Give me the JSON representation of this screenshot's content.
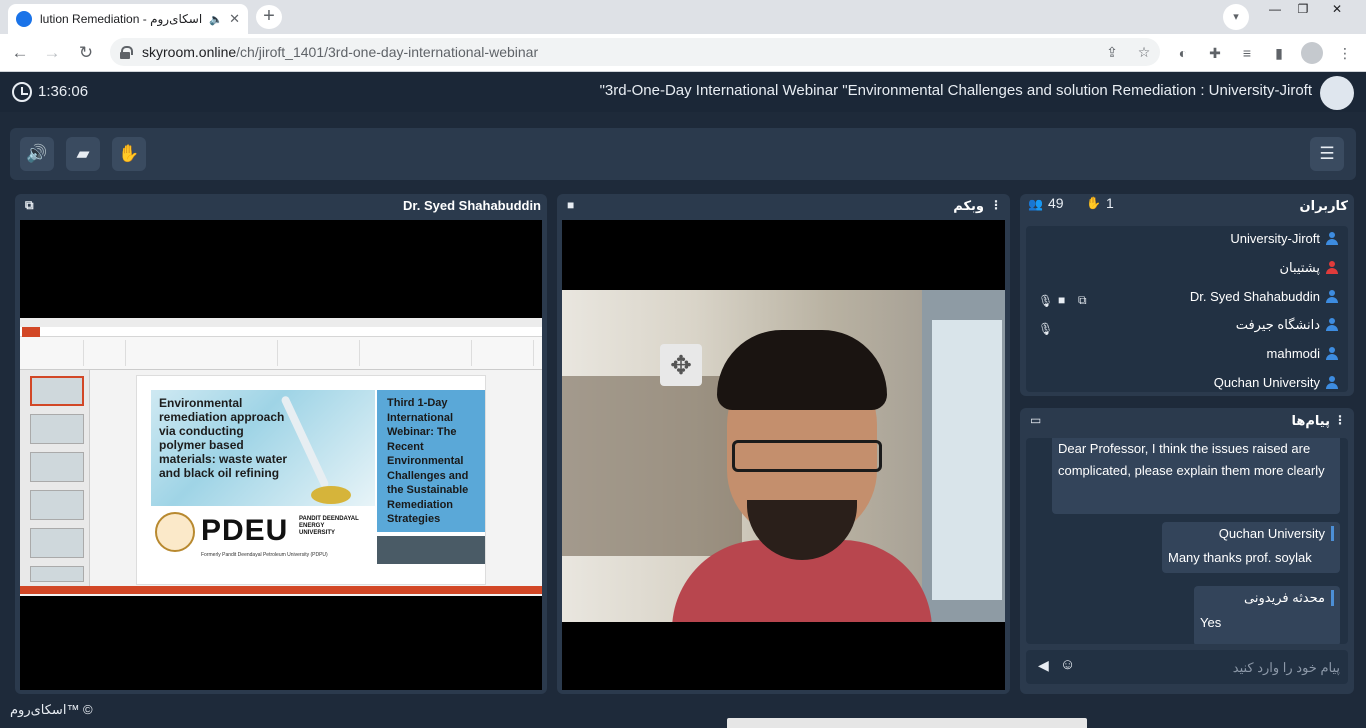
{
  "browser": {
    "tab_title": "lution Remediation - اسکای‌روم",
    "url_host": "skyroom.online",
    "url_path": "/ch/jiroft_1401/3rd-one-day-international-webinar"
  },
  "header": {
    "timer": "1:36:06",
    "room_title": "\"3rd-One-Day International Webinar \"Environmental Challenges and solution Remediation : University-Jiroft"
  },
  "panels": {
    "screen_title": "Dr. Syed Shahabuddin",
    "webcam_title": "وبکم",
    "users_title": "کاربران",
    "users_count": "49",
    "raised_hands": "1",
    "chat_title": "پیام‌ها"
  },
  "slide": {
    "left_text": "Environmental remediation approach via conducting polymer based materials: waste water and black oil refining",
    "logo": "PDEU",
    "logo_sub": "PANDIT DEENDAYAL ENERGY UNIVERSITY",
    "logo_foot": "Formerly Pandit Deendayal Petroleum University (PDPU)",
    "right_text": "Third 1-Day International Webinar: The Recent Environmental Challenges and the Sustainable Remediation Strategies"
  },
  "users": [
    {
      "name": "University-Jiroft",
      "color": "#3d8ce0"
    },
    {
      "name": "پشتیبان",
      "color": "#e03b3b"
    },
    {
      "name": "Dr. Syed Shahabuddin",
      "color": "#3d8ce0"
    },
    {
      "name": "دانشگاه جیرفت",
      "color": "#3d8ce0"
    },
    {
      "name": "mahmodi",
      "color": "#3d8ce0"
    },
    {
      "name": "Quchan University",
      "color": "#3d8ce0"
    }
  ],
  "messages": [
    {
      "sender": "",
      "text": "Dear Professor, I think the issues raised are complicated, please explain them more clearly"
    },
    {
      "sender": "Quchan University",
      "text": "Many thanks prof. soylak"
    },
    {
      "sender": "محدثه فریدونی",
      "text": "Yes"
    }
  ],
  "chat": {
    "placeholder": "پیام خود را وارد کنید"
  },
  "footer": {
    "brand": "اسکای‌روم™ ©"
  },
  "colors": {
    "accent": "#35b7e9",
    "bg": "#1e2a3a",
    "panel": "#2b3a4d"
  }
}
